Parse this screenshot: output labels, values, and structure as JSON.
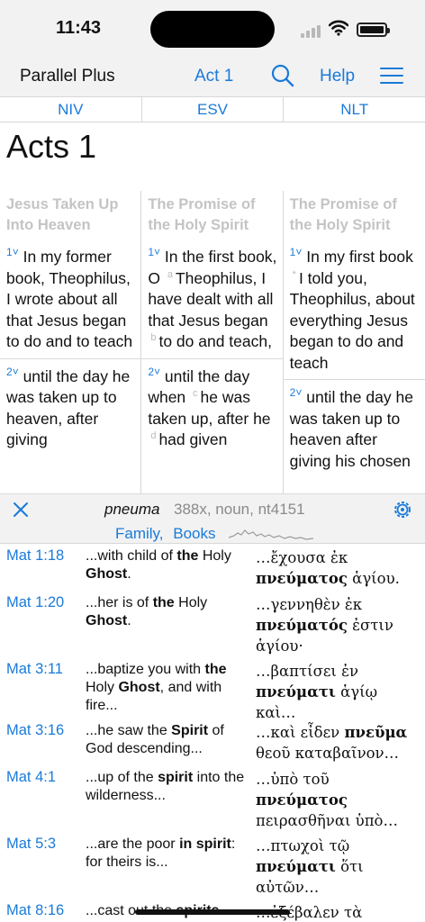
{
  "status": {
    "time": "11:43"
  },
  "nav": {
    "app_title": "Parallel Plus",
    "chapter": "Act 1",
    "help": "Help"
  },
  "versions": [
    "NIV",
    "ESV",
    "NLT"
  ],
  "chapter_title": "Acts 1",
  "columns": [
    {
      "heading": "Jesus Taken Up Into Heaven",
      "verses": [
        {
          "num": "1",
          "parts": [
            {
              "t": "In my former book, Theophilus, I wrote about all that Jesus began to do and to teach"
            }
          ]
        },
        {
          "num": "2",
          "parts": [
            {
              "t": "until the day he was taken up to heaven, after giving"
            }
          ]
        }
      ]
    },
    {
      "heading": "The Promise of the Holy Spirit",
      "verses": [
        {
          "num": "1",
          "parts": [
            {
              "t": "In the first book, O "
            },
            {
              "fn": "a"
            },
            {
              "t": "Theophilus, I have dealt with all that Jesus began "
            },
            {
              "fn": "b"
            },
            {
              "t": "to do and teach,"
            }
          ]
        },
        {
          "num": "2",
          "parts": [
            {
              "t": "until the day when "
            },
            {
              "fn": "c"
            },
            {
              "t": "he was taken up, after he "
            },
            {
              "fn": "d"
            },
            {
              "t": "had given"
            }
          ]
        }
      ]
    },
    {
      "heading": "The Promise of the Holy Spirit",
      "verses": [
        {
          "num": "1",
          "parts": [
            {
              "t": "In my first book "
            },
            {
              "fn": "*"
            },
            {
              "t": "I told you, Theophilus, about everything Jesus began to do and teach"
            }
          ]
        },
        {
          "num": "2",
          "parts": [
            {
              "t": "until the day he was taken up to heaven after giving his chosen"
            }
          ]
        }
      ]
    }
  ],
  "lexicon": {
    "word": "pneuma",
    "info": "388x, noun, nt4151",
    "link_family": "Family,",
    "link_books": "Books"
  },
  "results": [
    {
      "ref": "Mat 1:18",
      "eng": [
        {
          "t": "...with child of "
        },
        {
          "b": "the"
        },
        {
          "t": " Holy "
        },
        {
          "b": "Ghost"
        },
        {
          "t": "."
        }
      ],
      "grk": [
        {
          "t": "…ἔχουσα ἐκ "
        },
        {
          "b": "πνεύματος"
        },
        {
          "t": " ἁγίου."
        }
      ],
      "h": 52
    },
    {
      "ref": "Mat 1:20",
      "eng": [
        {
          "t": "...her is of "
        },
        {
          "b": "the"
        },
        {
          "t": " Holy "
        },
        {
          "b": "Ghost"
        },
        {
          "t": "."
        }
      ],
      "grk": [
        {
          "t": "…γεννηθὲν ἐκ "
        },
        {
          "b": "πνεύματός"
        },
        {
          "t": " ἐστιν ἁγίου·"
        }
      ],
      "h": 74
    },
    {
      "ref": "Mat 3:11",
      "eng": [
        {
          "t": "...baptize you with "
        },
        {
          "b": "the"
        },
        {
          "t": " Holy "
        },
        {
          "b": "Ghost"
        },
        {
          "t": ", and with fire..."
        }
      ],
      "grk": [
        {
          "t": "…βαπτίσει ἐν "
        },
        {
          "b": "πνεύματι"
        },
        {
          "t": " ἁγίῳ καὶ…"
        }
      ],
      "h": 68
    },
    {
      "ref": "Mat 3:16",
      "eng": [
        {
          "t": "...he saw the "
        },
        {
          "b": "Spirit"
        },
        {
          "t": " of God descending..."
        }
      ],
      "grk": [
        {
          "t": "…καὶ εἶδεν "
        },
        {
          "b": "πνεῦμα"
        },
        {
          "t": " θεοῦ καταβαῖνον…"
        }
      ],
      "h": 52
    },
    {
      "ref": "Mat 4:1",
      "eng": [
        {
          "t": "...up of the "
        },
        {
          "b": "spirit"
        },
        {
          "t": " into the wilderness..."
        }
      ],
      "grk": [
        {
          "t": "…ὑπὸ τοῦ "
        },
        {
          "b": "πνεύματος"
        },
        {
          "t": " πειρασθῆναι ὑπὸ…"
        }
      ],
      "h": 74
    },
    {
      "ref": "Mat 5:3",
      "eng": [
        {
          "t": "...are the poor "
        },
        {
          "b": "in spirit"
        },
        {
          "t": ": for theirs is..."
        }
      ],
      "grk": [
        {
          "t": "…πτωχοὶ τῷ "
        },
        {
          "b": "πνεύματι"
        },
        {
          "t": " ὅτι αὐτῶν…"
        }
      ],
      "h": 74
    },
    {
      "ref": "Mat 8:16",
      "eng": [
        {
          "t": "...cast out the "
        },
        {
          "b": "spirits"
        }
      ],
      "grk": [
        {
          "t": "…ἐξέβαλεν τὰ"
        }
      ],
      "h": 30
    }
  ]
}
